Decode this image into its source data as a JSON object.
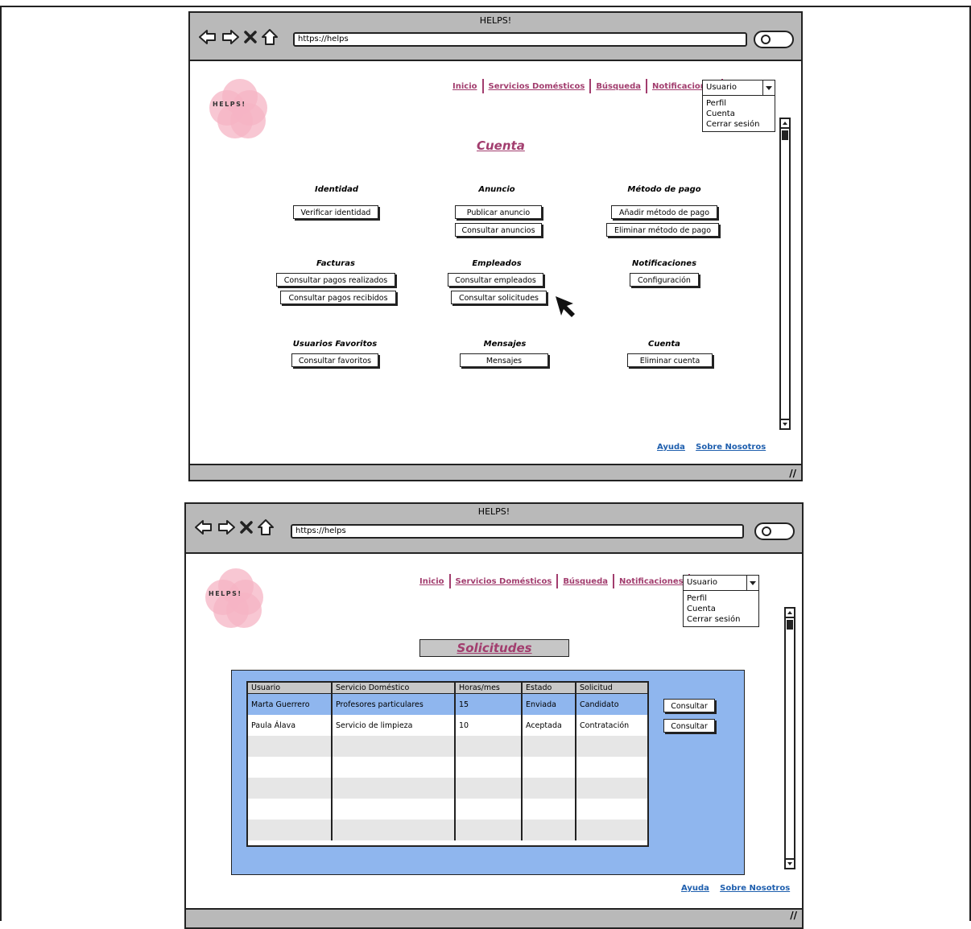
{
  "browser": {
    "title": "HELPS!",
    "url": "https://helps"
  },
  "logo": {
    "text": "HELPS!"
  },
  "nav": {
    "inicio": "Inicio",
    "servicios": "Servicios Domésticos",
    "busqueda": "Búsqueda",
    "notificaciones": "Notificaciones"
  },
  "user_menu": {
    "selected": "Usuario",
    "options": [
      "Perfil",
      "Cuenta",
      "Cerrar sesión"
    ]
  },
  "cuenta_page": {
    "title": "Cuenta",
    "sections": {
      "identidad": {
        "title": "Identidad",
        "buttons": [
          "Verificar identidad"
        ]
      },
      "anuncio": {
        "title": "Anuncio",
        "buttons": [
          "Publicar anuncio",
          "Consultar anuncios"
        ]
      },
      "metodo_pago": {
        "title": "Método de pago",
        "buttons": [
          "Añadir método de pago",
          "Eliminar método de pago"
        ]
      },
      "facturas": {
        "title": "Facturas",
        "buttons": [
          "Consultar pagos realizados",
          "Consultar pagos recibidos"
        ]
      },
      "empleados": {
        "title": "Empleados",
        "buttons": [
          "Consultar empleados",
          "Consultar solicitudes"
        ]
      },
      "notificaciones": {
        "title": "Notificaciones",
        "buttons": [
          "Configuración"
        ]
      },
      "favoritos": {
        "title": "Usuarios Favoritos",
        "buttons": [
          "Consultar favoritos"
        ]
      },
      "mensajes": {
        "title": "Mensajes",
        "buttons": [
          "Mensajes"
        ]
      },
      "cuenta": {
        "title": "Cuenta",
        "buttons": [
          "Eliminar cuenta"
        ]
      }
    }
  },
  "solicitudes_page": {
    "title": "Solicitudes",
    "columns": [
      "Usuario",
      "Servicio Doméstico",
      "Horas/mes",
      "Estado",
      "Solicitud"
    ],
    "rows": [
      [
        "Marta Guerrero",
        "Profesores particulares",
        "15",
        "Enviada",
        "Candidato"
      ],
      [
        "Paula Álava",
        "Servicio de limpieza",
        "10",
        "Aceptada",
        "Contratación"
      ]
    ],
    "row_action": "Consultar"
  },
  "footer": {
    "ayuda": "Ayuda",
    "sobre": "Sobre Nosotros"
  },
  "colors": {
    "accent": "#a23d6e",
    "link": "#1f5fae",
    "panel": "#8fb6ee",
    "chrome": "#b9b9b9"
  }
}
